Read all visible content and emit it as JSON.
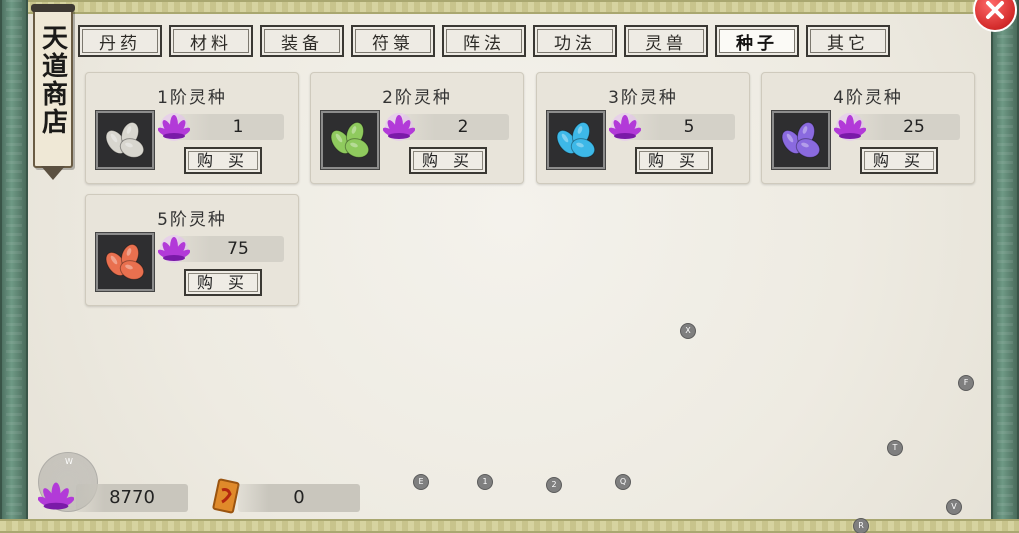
{
  "banner": {
    "title": "天道商店"
  },
  "tabs": [
    {
      "label": "丹药",
      "active": false
    },
    {
      "label": "材料",
      "active": false
    },
    {
      "label": "装备",
      "active": false
    },
    {
      "label": "符箓",
      "active": false
    },
    {
      "label": "阵法",
      "active": false
    },
    {
      "label": "功法",
      "active": false
    },
    {
      "label": "灵兽",
      "active": false
    },
    {
      "label": "种子",
      "active": true
    },
    {
      "label": "其它",
      "active": false
    }
  ],
  "items": [
    {
      "title": "1阶灵种",
      "price": "1",
      "seed_color": "#d8d6cf",
      "buy_label": "购 买"
    },
    {
      "title": "2阶灵种",
      "price": "2",
      "seed_color": "#8fca5e",
      "buy_label": "购 买"
    },
    {
      "title": "3阶灵种",
      "price": "5",
      "seed_color": "#3db8e8",
      "buy_label": "购 买"
    },
    {
      "title": "4阶灵种",
      "price": "25",
      "seed_color": "#8a6adf",
      "buy_label": "购 买"
    },
    {
      "title": "5阶灵种",
      "price": "75",
      "seed_color": "#e9704f",
      "buy_label": "购 买"
    }
  ],
  "currency": {
    "spirit_stones": "8770",
    "tokens": "0"
  },
  "joystick_label": "W",
  "key_hints": [
    "X",
    "F",
    "T",
    "E",
    "1",
    "2",
    "Q",
    "V",
    "R"
  ],
  "colors": {
    "lotus": "#b23ad8",
    "close_button": "#d22a2a",
    "token_icon": "#e08a2a"
  }
}
